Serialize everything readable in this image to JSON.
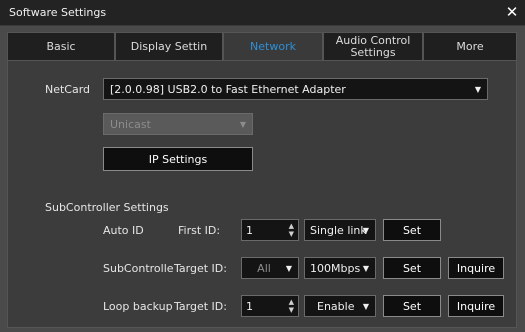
{
  "window": {
    "title": "Software Settings",
    "close_glyph": "✕"
  },
  "tabs": [
    {
      "label": "Basic"
    },
    {
      "label": "Display Settin"
    },
    {
      "label": "Network"
    },
    {
      "label": "Audio Control Settings"
    },
    {
      "label": "More"
    }
  ],
  "active_tab": "Network",
  "accent_color": "#2e8fd8",
  "network": {
    "netcard_label": "NetCard",
    "netcard_value": "[2.0.0.98] USB2.0 to Fast Ethernet Adapter",
    "cast_mode": "Unicast",
    "ip_settings_button": "IP Settings"
  },
  "subcontroller": {
    "section_title": "SubController Settings",
    "auto_id": {
      "label": "Auto ID",
      "field_label": "First ID:",
      "value": "1",
      "link_mode": "Single link",
      "set_button": "Set"
    },
    "subcontroller_row": {
      "label": "SubControlle",
      "field_label": "Target ID:",
      "target": "All",
      "speed": "100Mbps",
      "set_button": "Set",
      "inquire_button": "Inquire"
    },
    "loop_backup": {
      "label": "Loop backup",
      "field_label": "Target ID:",
      "value": "1",
      "mode": "Enable",
      "set_button": "Set",
      "inquire_button": "Inquire"
    }
  },
  "icons": {
    "dropdown": "caret-down-icon",
    "spinner": "spinner-arrows-icon",
    "close": "close-icon"
  }
}
